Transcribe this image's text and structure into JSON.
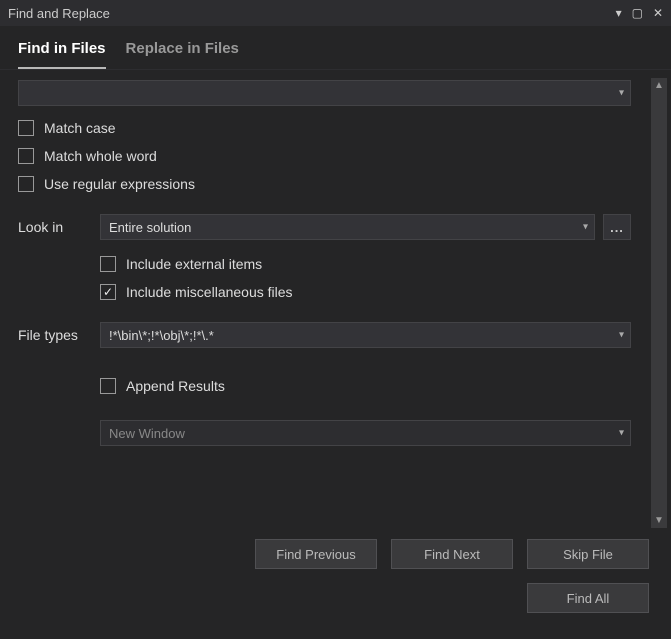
{
  "window": {
    "title": "Find and Replace"
  },
  "tabs": {
    "find": "Find in Files",
    "replace": "Replace in Files",
    "active": "find"
  },
  "search": {
    "value": ""
  },
  "options": {
    "matchCase": {
      "label": "Match case",
      "checked": false
    },
    "wholeWord": {
      "label": "Match whole word",
      "checked": false
    },
    "regex": {
      "label": "Use regular expressions",
      "checked": false
    }
  },
  "lookIn": {
    "label": "Look in",
    "value": "Entire solution",
    "browse": "...",
    "includeExternal": {
      "label": "Include external items",
      "checked": false
    },
    "includeMisc": {
      "label": "Include miscellaneous files",
      "checked": true
    }
  },
  "fileTypes": {
    "label": "File types",
    "value": "!*\\bin\\*;!*\\obj\\*;!*\\.*"
  },
  "results": {
    "append": {
      "label": "Append Results",
      "checked": false
    },
    "window": "New Window"
  },
  "buttons": {
    "findPrev": "Find Previous",
    "findNext": "Find Next",
    "skipFile": "Skip File",
    "findAll": "Find All"
  }
}
